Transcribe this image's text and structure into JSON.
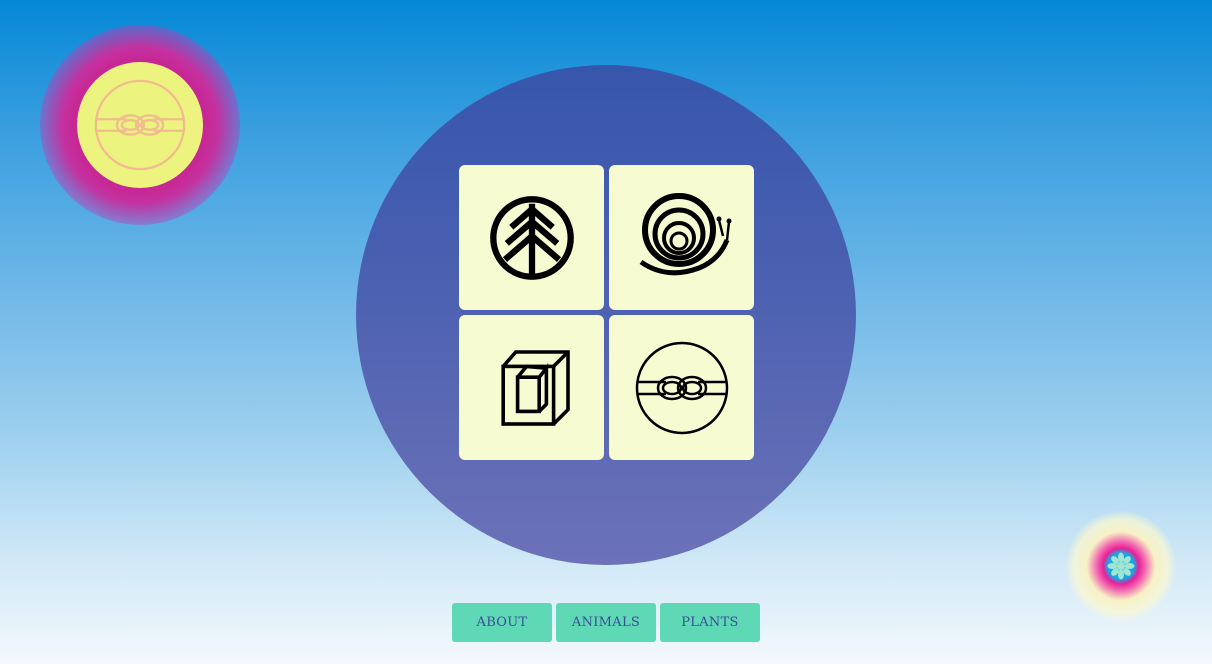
{
  "colors": {
    "background_top": "#0588d7",
    "background_bottom": "#f4f9fd",
    "main_circle": "#4c61b1",
    "tile": "#f7fbd2",
    "nav_button": "#5ed8b5",
    "nav_text": "#3a4f96",
    "orb_large_core": "#ecf37e",
    "orb_large_glow": "#c8238f",
    "orb_small_core": "#1aa6e1",
    "orb_small_ring": "#e8209a"
  },
  "decor": {
    "orb_large_icon": "knot-circle-icon",
    "orb_small_icon": "snowflake-flower-icon"
  },
  "tiles": [
    {
      "icon": "tree-circle-icon"
    },
    {
      "icon": "snail-icon"
    },
    {
      "icon": "impossible-frame-icon"
    },
    {
      "icon": "knot-circle-icon"
    }
  ],
  "nav": {
    "about_label": "ABOUT",
    "animals_label": "ANIMALS",
    "plants_label": "PLANTS"
  }
}
